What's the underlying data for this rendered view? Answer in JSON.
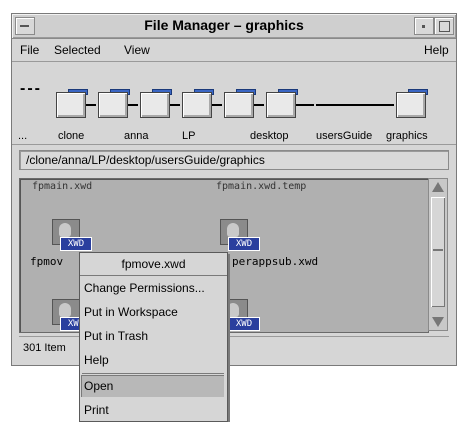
{
  "window": {
    "title": "File Manager – graphics"
  },
  "menubar": {
    "file": "File",
    "selected": "Selected",
    "view": "View",
    "help": "Help"
  },
  "path": {
    "ellipsis_icon": "---",
    "folders": [
      {
        "label": "..."
      },
      {
        "label": "clone"
      },
      {
        "label": "anna"
      },
      {
        "label": "LP"
      },
      {
        "label": "desktop"
      },
      {
        "label": "usersGuide"
      },
      {
        "label": "graphics"
      }
    ],
    "current_path": "/clone/anna/LP/desktop/usersGuide/graphics"
  },
  "files": [
    {
      "cut_label": "fpmain.xwd",
      "name": "fpmov",
      "badge": "XWD"
    },
    {
      "cut_label": "fpmain.xwd.temp",
      "name": "perappsub.xwd",
      "badge": "XWD"
    },
    {
      "name": "",
      "badge": "XWD"
    },
    {
      "name": "",
      "badge": "XWD"
    }
  ],
  "status": {
    "text": "301 Item"
  },
  "context_menu": {
    "title": "fpmove.xwd",
    "items": [
      "Change Permissions...",
      "Put in Workspace",
      "Put in Trash",
      "Help",
      "Open",
      "Print"
    ],
    "selected": "Open"
  },
  "icons": {
    "window_menu": "window-menu-icon",
    "minimize": "minimize-icon",
    "maximize": "maximize-icon",
    "folder": "folder-icon",
    "image_file": "xwd-image-icon"
  },
  "colors": {
    "badge": "#2a3f9e",
    "folder_tab": "#3a66c4",
    "pane": "#b0b0b0"
  }
}
